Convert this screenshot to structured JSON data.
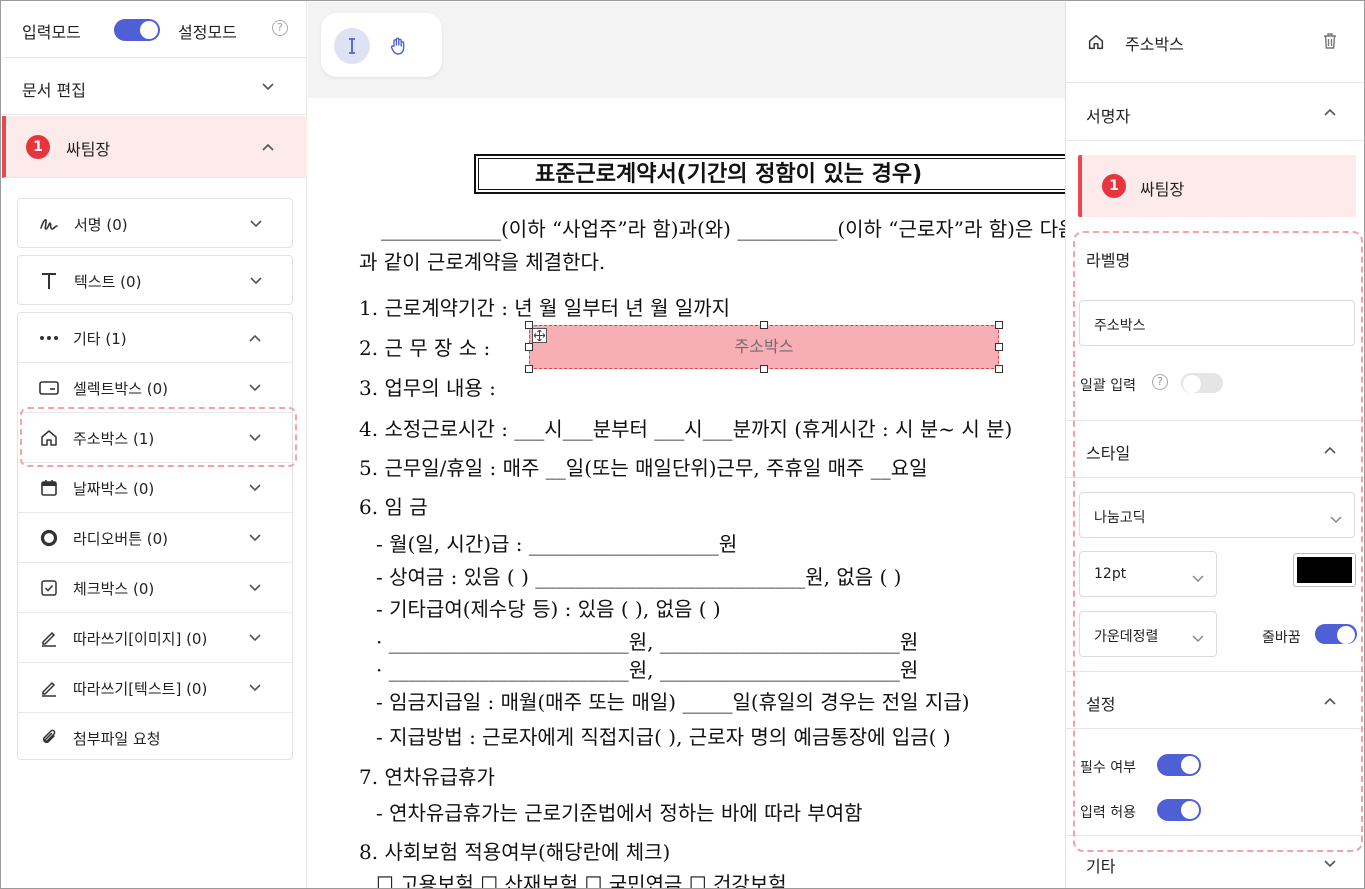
{
  "left_panel": {
    "input_mode": "입력모드",
    "setting_mode": "설정모드",
    "help": "?",
    "doc_edit": "문서 편집",
    "signer": {
      "badge": "1",
      "name": "싸팀장"
    },
    "groups": {
      "signature": "서명 (0)",
      "text": "텍스트 (0)",
      "other": "기타 (1)"
    },
    "other_items": [
      {
        "label": "셀렉트박스 (0)",
        "icon": "select-box-icon"
      },
      {
        "label": "주소박스 (1)",
        "icon": "home-icon"
      },
      {
        "label": "날짜박스 (0)",
        "icon": "calendar-icon"
      },
      {
        "label": "라디오버튼 (0)",
        "icon": "radio-icon"
      },
      {
        "label": "체크박스 (0)",
        "icon": "checkbox-icon"
      },
      {
        "label": "따라쓰기[이미지] (0)",
        "icon": "pen-icon"
      },
      {
        "label": "따라쓰기[텍스트] (0)",
        "icon": "pen-icon"
      },
      {
        "label": "첨부파일 요청",
        "icon": "paperclip-icon"
      }
    ]
  },
  "toolbar": {
    "tools": [
      "text-cursor-icon",
      "hand-icon"
    ]
  },
  "document": {
    "title": "표준근로계약서(기간의 정함이 있는 경우)",
    "lines": [
      "____________(이하 “사업주”라 함)과(와) __________(이하 “근로자”라 함)은 다음",
      "과 같이 근로계약을 체결한다.",
      "1. 근로계약기간 :        년    월    일부터        년    월    일까지",
      "2. 근 무 장 소 :",
      "3. 업무의 내용 :",
      "4. 소정근로시간 : ___시___분부터 ___시___분까지 (휴게시간 :  시  분~  시  분)",
      "5. 근무일/휴일 : 매주 __일(또는 매일단위)근무, 주휴일 매주 __요일",
      "6. 임   금",
      "  - 월(일, 시간)급 : ___________________원",
      "  - 상여금 : 있음 (    ) ___________________________원,  없음 (    )",
      "  - 기타급여(제수당 등) : 있음 (    ),    없음 (    )",
      "     · ________________________원,  ________________________원",
      "     · ________________________원,  ________________________원",
      "  - 임금지급일 : 매월(매주 또는 매일) _____일(휴일의 경우는 전일 지급)",
      "  - 지급방법 : 근로자에게 직접지급(    ),  근로자 명의 예금통장에 입금(    )",
      "7. 연차유급휴가",
      "  - 연차유급휴가는 근로기준법에서 정하는 바에 따라 부여함",
      "8. 사회보험 적용여부(해당란에 체크)",
      "  ☐ 고용보험  ☐ 산재보험  ☐ 국민연금  ☐ 건강보험"
    ],
    "address_box_label": "주소박스"
  },
  "right_panel": {
    "header_title": "주소박스",
    "signer_section": "서명자",
    "signer": {
      "badge": "1",
      "name": "싸팀장"
    },
    "label_section": "라벨명",
    "label_value": "주소박스",
    "bulk_input": "일괄 입력",
    "style_section": "스타일",
    "font": "나눔고딕",
    "size": "12pt",
    "color": "#000000",
    "align": "가운데정렬",
    "wrap": "줄바꿈",
    "settings_section": "설정",
    "required": "필수 여부",
    "allow_input": "입력 허용",
    "other_section": "기타"
  },
  "colors": {
    "accent": "#4f5fd6",
    "danger": "#e8353d",
    "signer_bg": "#fdeaea",
    "address_fill": "#f7aeb4"
  }
}
